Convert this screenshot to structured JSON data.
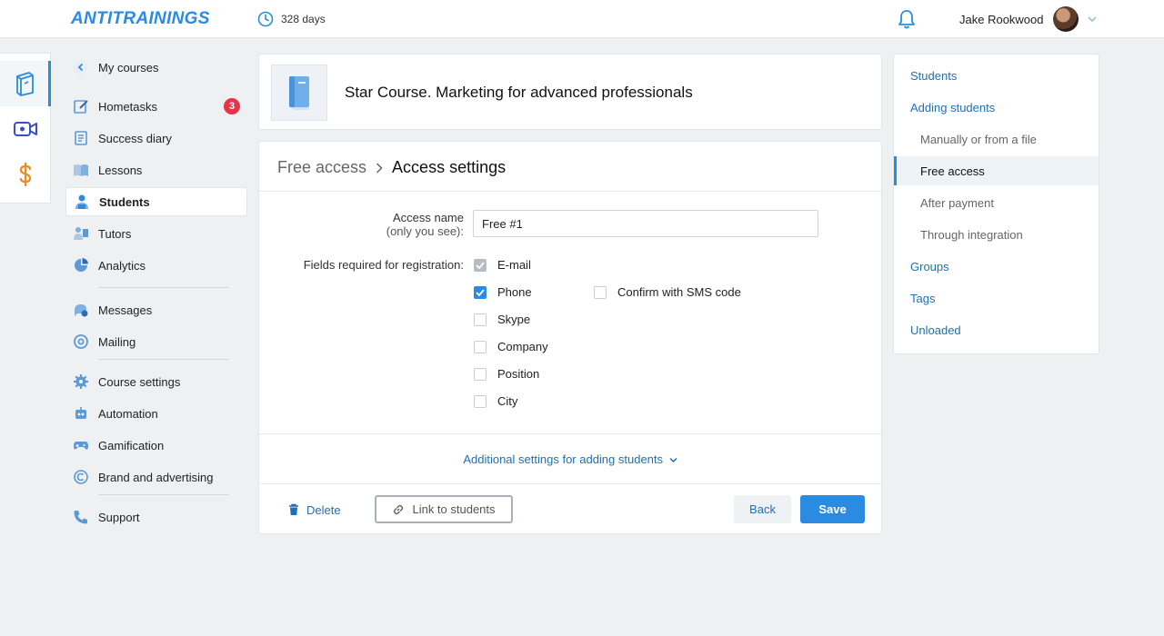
{
  "header": {
    "logo": "ANTITRAININGS",
    "days": "328 days",
    "user_name": "Jake Rookwood"
  },
  "nav": {
    "back": "My courses",
    "items": [
      {
        "label": "Hometasks",
        "badge": "3"
      },
      {
        "label": "Success diary"
      },
      {
        "label": "Lessons"
      },
      {
        "label": "Students"
      },
      {
        "label": "Tutors"
      },
      {
        "label": "Analytics"
      },
      {
        "label": "Messages"
      },
      {
        "label": "Mailing"
      },
      {
        "label": "Course settings"
      },
      {
        "label": "Automation"
      },
      {
        "label": "Gamification"
      },
      {
        "label": "Brand and advertising"
      },
      {
        "label": "Support"
      }
    ]
  },
  "course": {
    "title": "Star Course. Marketing for advanced professionals"
  },
  "form": {
    "breadcrumb_prev": "Free access",
    "breadcrumb_current": "Access settings",
    "access_name_label": "Access name",
    "access_name_hint": "(only you see):",
    "access_name_value": "Free #1",
    "fields_label": "Fields required for registration:",
    "fields": [
      {
        "label": "E-mail",
        "state": "checked-disabled"
      },
      {
        "label": "Phone",
        "state": "checked"
      },
      {
        "label": "Skype",
        "state": "unchecked"
      },
      {
        "label": "Company",
        "state": "unchecked"
      },
      {
        "label": "Position",
        "state": "unchecked"
      },
      {
        "label": "City",
        "state": "unchecked"
      }
    ],
    "confirm_sms": "Confirm with SMS code",
    "more_settings": "Additional settings for adding students",
    "delete": "Delete",
    "link_students": "Link to students",
    "back": "Back",
    "save": "Save"
  },
  "right_panel": {
    "items": [
      {
        "label": "Students"
      },
      {
        "label": "Adding students"
      },
      {
        "label": "Manually or from a file"
      },
      {
        "label": "Free access"
      },
      {
        "label": "After payment"
      },
      {
        "label": "Through integration"
      },
      {
        "label": "Groups"
      },
      {
        "label": "Tags"
      },
      {
        "label": "Unloaded"
      }
    ]
  },
  "colors": {
    "accent": "#2a8be0",
    "link": "#1f6fb5",
    "badge": "#e8344a",
    "money": "#f08a1c"
  }
}
